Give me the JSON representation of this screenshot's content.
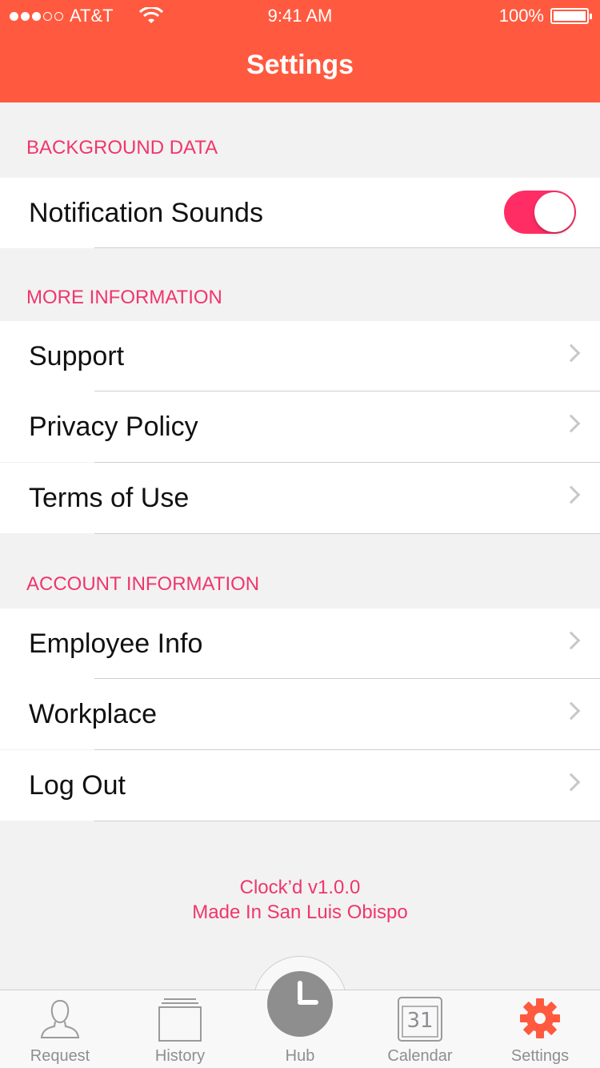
{
  "status_bar": {
    "carrier": "AT&T",
    "time": "9:41 AM",
    "battery": "100%"
  },
  "header": {
    "title": "Settings"
  },
  "sections": {
    "background_data": {
      "title": "BACKGROUND DATA",
      "notification_sounds": {
        "label": "Notification Sounds",
        "enabled": true
      }
    },
    "more_information": {
      "title": "MORE INFORMATION",
      "items": [
        "Support",
        "Privacy Policy",
        "Terms of Use"
      ]
    },
    "account_information": {
      "title": "ACCOUNT INFORMATION",
      "items": [
        "Employee Info",
        "Workplace",
        "Log Out"
      ]
    }
  },
  "footer": {
    "version": "Clock’d v1.0.0",
    "made_in": "Made In San Luis Obispo"
  },
  "tabbar": {
    "tabs": [
      {
        "label": "Request",
        "icon": "person-icon"
      },
      {
        "label": "History",
        "icon": "stack-icon"
      },
      {
        "label": "Hub",
        "icon": "clock-icon"
      },
      {
        "label": "Calendar",
        "icon": "calendar-icon",
        "day": "31"
      },
      {
        "label": "Settings",
        "icon": "gear-icon"
      }
    ],
    "active": "Settings"
  },
  "colors": {
    "brand": "#ff5a3f",
    "accent": "#f0366b",
    "toggle_on": "#ff2d63"
  }
}
